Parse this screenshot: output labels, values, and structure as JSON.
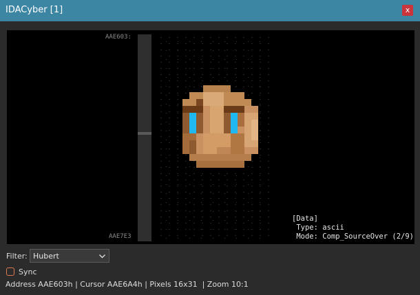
{
  "window": {
    "title": "IDACyber [1]",
    "close_label": "x"
  },
  "viewport": {
    "address_start": "AAE603:",
    "address_end": "AAE7E3"
  },
  "info_panel": {
    "header": "[Data]",
    "type_line": " Type: ascii",
    "mode_line": " Mode: Comp_SourceOver (2/9)"
  },
  "filter": {
    "label": "Filter:",
    "value": "Hubert"
  },
  "sync": {
    "label": "Sync",
    "checked": false
  },
  "status": {
    "text": "Address AAE603h | Cursor AAE6A4h | Pixels 16x31  | Zoom 10:1"
  },
  "colors": {
    "titlebar": "#3c86a3",
    "close": "#c9353a",
    "sync_check": "#e07a55"
  }
}
